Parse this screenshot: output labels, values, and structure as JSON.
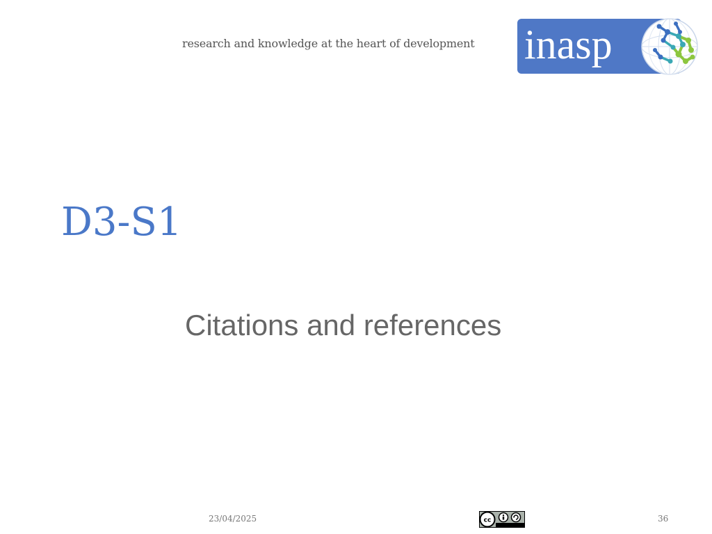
{
  "header": {
    "tagline": "research and knowledge at the heart of development",
    "logo": {
      "text": "inasp",
      "icon": "globe-network-icon",
      "colors": {
        "box": "#4f78c6",
        "green": "#8cc63f",
        "teal": "#3aa8b5",
        "blue": "#3c6fc0"
      }
    }
  },
  "slide": {
    "title": "D3-S1",
    "subtitle": "Citations and references",
    "title_color": "#4a78c8"
  },
  "footer": {
    "date": "23/04/2025",
    "license_badge": "cc-by-sa-icon",
    "page_number": "36"
  }
}
